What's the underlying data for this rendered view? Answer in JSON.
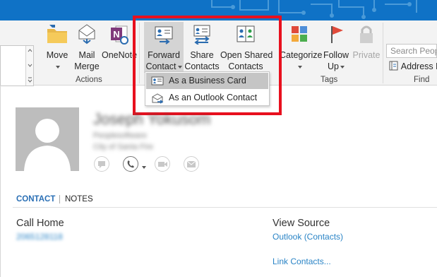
{
  "ribbon": {
    "move": {
      "label": "Move"
    },
    "mail_merge": {
      "label_line1": "Mail",
      "label_line2": "Merge"
    },
    "onenote": {
      "label": "OneNote"
    },
    "forward_contact": {
      "label_line1": "Forward",
      "label_line2": "Contact"
    },
    "share_contacts": {
      "label_line1": "Share",
      "label_line2": "Contacts"
    },
    "open_shared_contacts": {
      "label_line1": "Open Shared",
      "label_line2": "Contacts"
    },
    "categorize": {
      "label": "Categorize"
    },
    "follow_up": {
      "label_line1": "Follow",
      "label_line2": "Up"
    },
    "private": {
      "label": "Private"
    },
    "search": {
      "placeholder": "Search People"
    },
    "address_book": {
      "label": "Address B"
    },
    "groups": {
      "actions": "Actions",
      "tags": "Tags",
      "find": "Find"
    }
  },
  "forward_menu": {
    "items": [
      {
        "label": "As a Business Card",
        "highlighted": true
      },
      {
        "label": "As an Outlook Contact",
        "highlighted": false
      }
    ]
  },
  "contact": {
    "name": "Joseph Yokusom",
    "title": "Peoplesoftware",
    "company": "City of Santa Fire"
  },
  "tabs": {
    "contact": "CONTACT",
    "notes": "NOTES"
  },
  "fields": {
    "call_home": {
      "label": "Call Home",
      "value": "2065128118"
    },
    "view_source": {
      "label": "View Source",
      "value": "Outlook (Contacts)"
    },
    "link_contacts": "Link Contacts..."
  },
  "colors": {
    "titlebar": "#0f72c6",
    "highlight": "#c5c5c5",
    "annotation": "#e8101e",
    "link": "#2a84c6"
  }
}
